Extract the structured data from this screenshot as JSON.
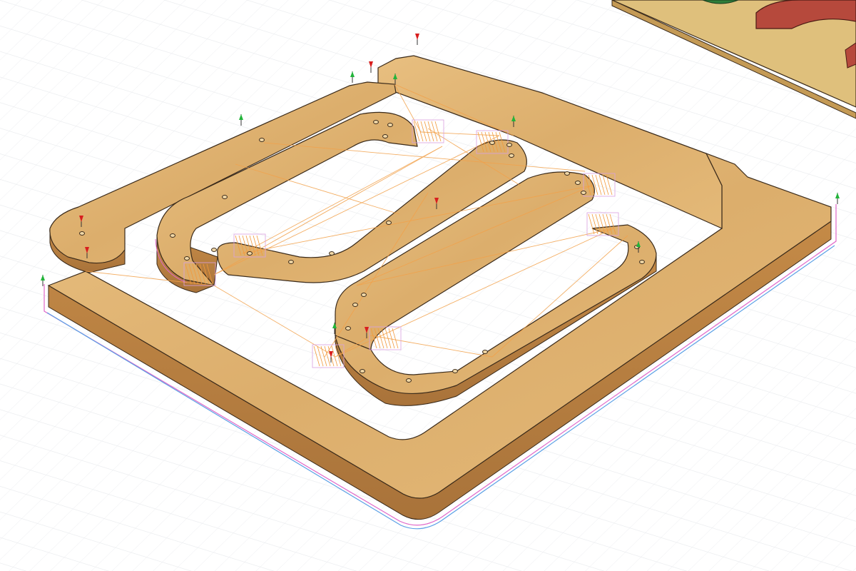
{
  "viewport": {
    "background": "#ffffff",
    "grid_major": "#cfd3d8",
    "grid_minor": "#e9ebee"
  },
  "colors": {
    "wood_light": "#e3b877",
    "wood_dark": "#cf9a56",
    "wood_side": "#b9823f",
    "edge_line": "#3a2a1a",
    "toolpath_offset": "#e066c8",
    "toolpath_bottom": "#5aa0e6",
    "rapid_move": "#f2a14a",
    "ramp_path": "#f29a3c",
    "entry_marker": "#d81e1e",
    "exit_marker": "#22b43a",
    "other_part_red": "#b6493c",
    "other_part_green": "#2e7d3a",
    "rail_wood": "#dfc07c"
  },
  "markers": {
    "entry_icon": "down-arrow-marker-icon",
    "exit_icon": "up-arrow-marker-icon"
  }
}
